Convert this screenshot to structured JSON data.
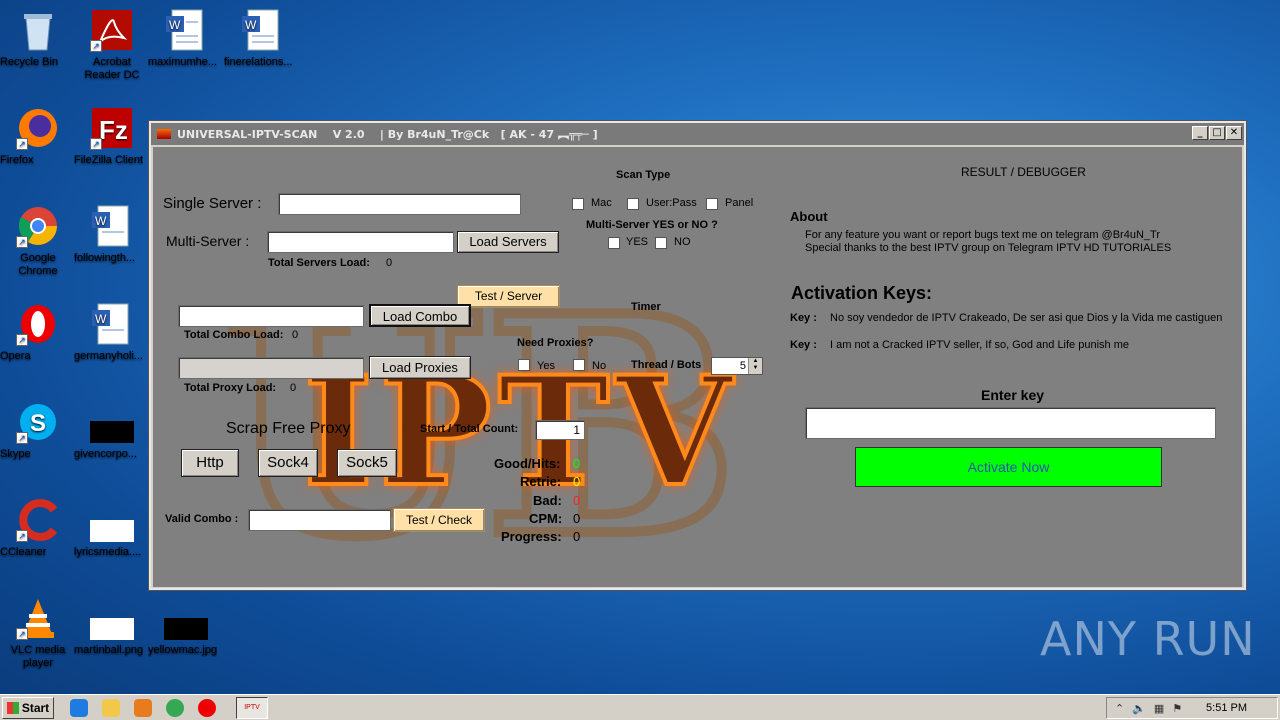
{
  "desktop": {
    "icons": [
      {
        "label": "Recycle Bin",
        "icon": "recycle-bin-icon"
      },
      {
        "label": "Acrobat Reader DC",
        "icon": "acrobat-icon"
      },
      {
        "label": "maximumhe...",
        "icon": "word-doc-icon"
      },
      {
        "label": "finerelations...",
        "icon": "word-doc-icon"
      },
      {
        "label": "Firefox",
        "icon": "firefox-icon"
      },
      {
        "label": "FileZilla Client",
        "icon": "filezilla-icon"
      },
      {
        "label": "Google Chrome",
        "icon": "chrome-icon"
      },
      {
        "label": "followingth...",
        "icon": "word-doc-icon"
      },
      {
        "label": "Opera",
        "icon": "opera-icon"
      },
      {
        "label": "germanyholi...",
        "icon": "word-doc-icon"
      },
      {
        "label": "Skype",
        "icon": "skype-icon"
      },
      {
        "label": "givencorpo...",
        "icon": "black-file-icon"
      },
      {
        "label": "CCleaner",
        "icon": "ccleaner-icon"
      },
      {
        "label": "lyricsmedia....",
        "icon": "blank-file-icon"
      },
      {
        "label": "VLC media player",
        "icon": "vlc-icon"
      },
      {
        "label": "martinball.png",
        "icon": "blank-file-icon"
      },
      {
        "label": "yellowmac.jpg",
        "icon": "black-file-icon"
      }
    ],
    "watermark": "ANY RUN"
  },
  "window": {
    "title": "UNIVERSAL-IPTV-SCAN    V 2.0    | By Br4uN_Tr@Ck   [ AK - 47 ︻╦╤─ ]",
    "min": "_",
    "max": "□",
    "close": "✕"
  },
  "form": {
    "single_server_label": "Single Server :",
    "single_server_value": "",
    "multi_server_label": "Multi-Server :",
    "multi_server_value": "",
    "load_servers": "Load Servers",
    "total_servers_label": "Total Servers Load:",
    "total_servers_value": "0",
    "test_server": "Test / Server",
    "combo_value": "",
    "load_combo": "Load Combo",
    "total_combo_label": "Total Combo Load:",
    "total_combo_value": "0",
    "proxies_value": "",
    "load_proxies": "Load Proxies",
    "total_proxy_label": "Total Proxy Load:",
    "total_proxy_value": "0",
    "scrap_title": "Scrap Free Proxy",
    "http": "Http",
    "sock4": "Sock4",
    "sock5": "Sock5",
    "valid_combo_label": "Valid Combo :",
    "valid_combo_value": "",
    "test_check": "Test / Check"
  },
  "scan": {
    "scan_type_label": "Scan Type",
    "mac": "Mac",
    "userpass": "User:Pass",
    "panel": "Panel",
    "multi_yes_no_label": "Multi-Server YES or NO ?",
    "yes": "YES",
    "no": "NO",
    "timer_label": "Timer",
    "need_proxies_label": "Need Proxies?",
    "proxy_yes": "Yes",
    "proxy_no": "No",
    "thread_label": "Thread / Bots",
    "thread_value": "5",
    "start_total_label": "Start / Total Count:",
    "start_total_value": "1"
  },
  "stats": {
    "good_label": "Good/Hits:",
    "good_value": "0",
    "retrie_label": "Retrie:",
    "retrie_value": "0",
    "bad_label": "Bad:",
    "bad_value": "0",
    "cpm_label": "CPM:",
    "cpm_value": "0",
    "progress_label": "Progress:",
    "progress_value": "0"
  },
  "right": {
    "result_title": "RESULT / DEBUGGER",
    "about_title": "About",
    "about_line1": "For any feature you want or report bugs text me on telegram @Br4uN_Tr",
    "about_line2": "Special thanks to the best IPTV group on Telegram IPTV HD TUTORIALES",
    "activation_title": "Activation Keys:",
    "key1_label": "Key :",
    "key1_text": "No soy vendedor de IPTV Crakeado, De ser asi que Dios y la Vida me castiguen",
    "key2_label": "Key :",
    "key2_text": "I am not a Cracked IPTV seller, If so, God and Life punish me",
    "enter_key_label": "Enter key",
    "enter_key_value": "",
    "activate": "Activate Now"
  },
  "background_logo": {
    "letters": "UB",
    "word": "IPTV"
  },
  "taskbar": {
    "start": "Start",
    "task_label": "IPTV",
    "clock": "5:51 PM"
  },
  "colors": {
    "green_stat": "#00ff00",
    "yellow_stat": "#ffff00",
    "red_stat": "#ff2020",
    "activate_bg": "#00ff00"
  }
}
